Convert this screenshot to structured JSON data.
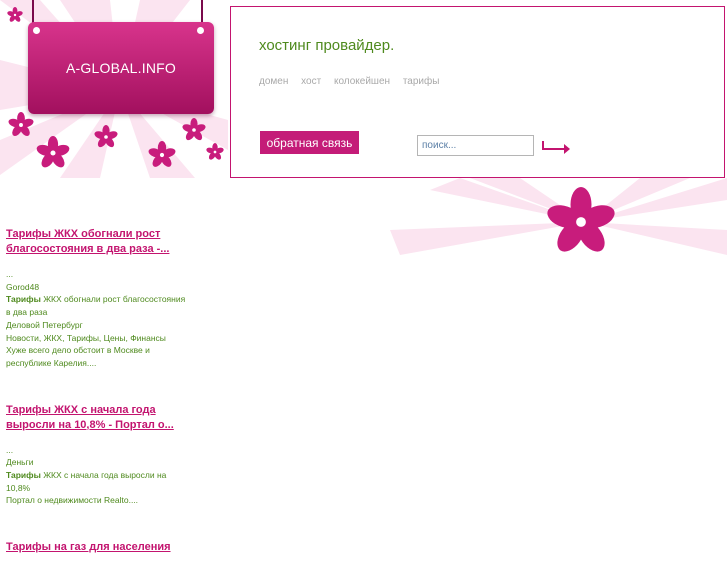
{
  "site": {
    "sign_title": "A-GLOBAL.INFO",
    "heading": "хостинг провайдер.",
    "nav": [
      "домен",
      "хост",
      "колокейшен",
      "тарифы"
    ],
    "feedback_label": "обратная связь",
    "search_placeholder": "поиск..."
  },
  "colors": {
    "accent_pink": "#c3146f",
    "text_green": "#4f8a1e",
    "nav_gray": "#a9a9a9"
  },
  "articles": [
    {
      "title": "Тарифы ЖКХ обогнали рост благосостояния в два раза -...",
      "lines": [
        {
          "pre": "",
          "strong": "",
          "post": "..."
        },
        {
          "pre": "",
          "strong": "",
          "post": "Gorod48"
        },
        {
          "pre": "",
          "strong": "Тарифы",
          "post": " ЖКХ обогнали рост благосостояния в два раза"
        },
        {
          "pre": "",
          "strong": "",
          "post": "Деловой Петербург"
        },
        {
          "pre": "",
          "strong": "",
          "post": "Новости, ЖКХ, Тарифы, Цены, Финансы Хуже всего дело обстоит в Москве и республике Карелия...."
        }
      ]
    },
    {
      "title": "Тарифы ЖКХ с начала года выросли на 10,8% - Портал о...",
      "lines": [
        {
          "pre": "",
          "strong": "",
          "post": "..."
        },
        {
          "pre": "",
          "strong": "",
          "post": "Деньги"
        },
        {
          "pre": "",
          "strong": "Тарифы",
          "post": " ЖКХ с начала года выросли на 10,8%"
        },
        {
          "pre": "",
          "strong": "",
          "post": "Портал о недвижимости Realto...."
        }
      ]
    },
    {
      "title": "Тарифы на газ для населения",
      "lines": []
    }
  ]
}
